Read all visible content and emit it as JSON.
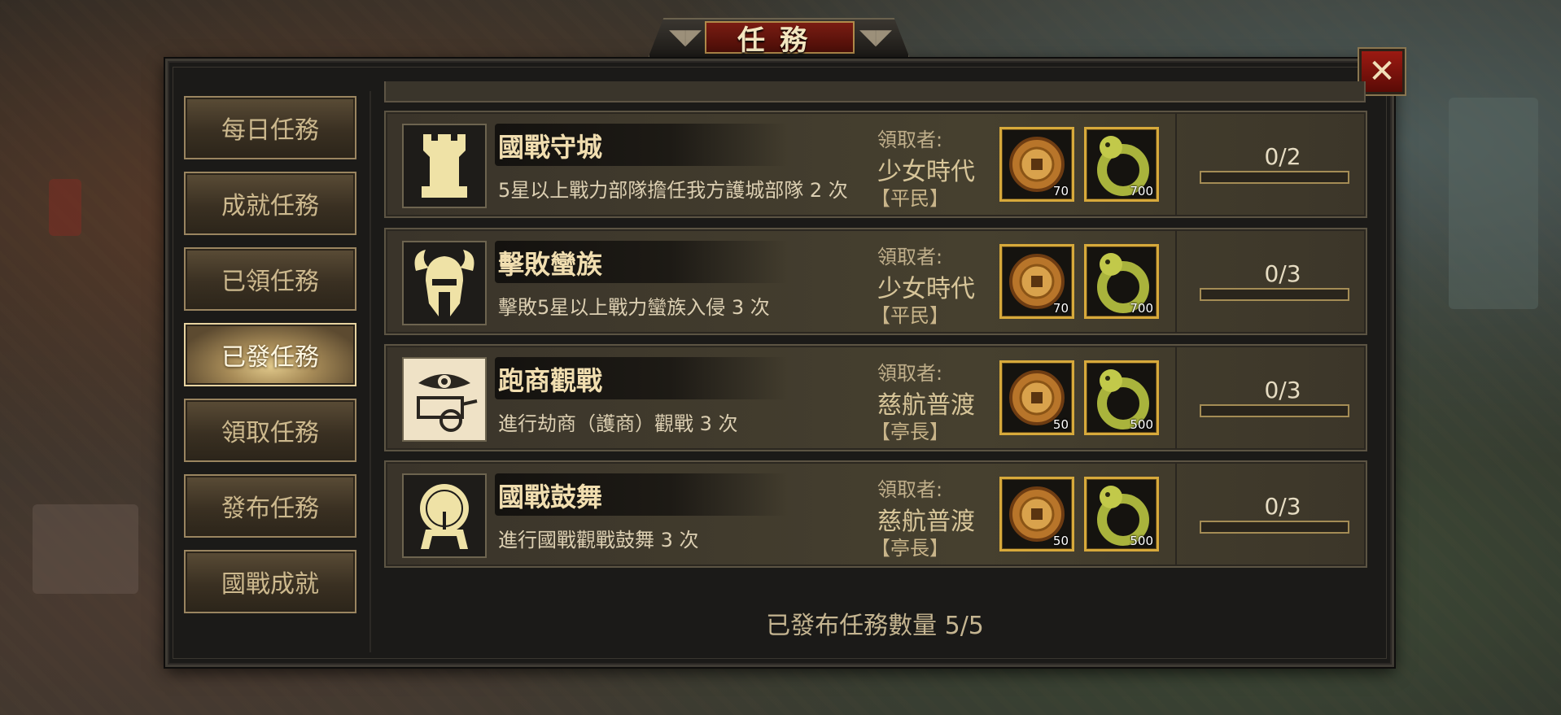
{
  "window": {
    "title": "任務",
    "close_icon": "close-icon"
  },
  "sidebar": {
    "items": [
      {
        "label": "每日任務",
        "active": false
      },
      {
        "label": "成就任務",
        "active": false
      },
      {
        "label": "已領任務",
        "active": false
      },
      {
        "label": "已發任務",
        "active": true
      },
      {
        "label": "領取任務",
        "active": false
      },
      {
        "label": "發布任務",
        "active": false
      },
      {
        "label": "國戰成就",
        "active": false
      }
    ]
  },
  "quests": [
    {
      "name": "國戰守城",
      "icon": "castle-tower-icon",
      "description": "5星以上戰力部隊擔任我方護城部隊 2 次",
      "claimer_label": "領取者:",
      "claimer_name": "少女時代",
      "claimer_rank": "【平民】",
      "rewards": [
        {
          "icon": "bronze-coin-icon",
          "qty": "70"
        },
        {
          "icon": "jade-dragon-ring-icon",
          "qty": "700"
        }
      ],
      "progress_text": "0/2",
      "progress": 0
    },
    {
      "name": "擊敗蠻族",
      "icon": "horned-helmet-icon",
      "description": "擊敗5星以上戰力蠻族入侵 3 次",
      "claimer_label": "領取者:",
      "claimer_name": "少女時代",
      "claimer_rank": "【平民】",
      "rewards": [
        {
          "icon": "bronze-coin-icon",
          "qty": "70"
        },
        {
          "icon": "jade-dragon-ring-icon",
          "qty": "700"
        }
      ],
      "progress_text": "0/3",
      "progress": 0
    },
    {
      "name": "跑商觀戰",
      "icon": "cart-eye-icon",
      "description": "進行劫商（護商）觀戰 3 次",
      "claimer_label": "領取者:",
      "claimer_name": "慈航普渡",
      "claimer_rank": "【亭長】",
      "rewards": [
        {
          "icon": "bronze-coin-icon",
          "qty": "50"
        },
        {
          "icon": "jade-dragon-ring-icon",
          "qty": "500"
        }
      ],
      "progress_text": "0/3",
      "progress": 0
    },
    {
      "name": "國戰鼓舞",
      "icon": "war-drum-icon",
      "description": "進行國戰觀戰鼓舞 3 次",
      "claimer_label": "領取者:",
      "claimer_name": "慈航普渡",
      "claimer_rank": "【亭長】",
      "rewards": [
        {
          "icon": "bronze-coin-icon",
          "qty": "50"
        },
        {
          "icon": "jade-dragon-ring-icon",
          "qty": "500"
        }
      ],
      "progress_text": "0/3",
      "progress": 0
    }
  ],
  "footer": {
    "published_count": "已發布任務數量 5/5"
  },
  "colors": {
    "accent_gold": "#d7a93b",
    "title_red": "#7a1c12",
    "text_gold": "#f1deb0"
  }
}
